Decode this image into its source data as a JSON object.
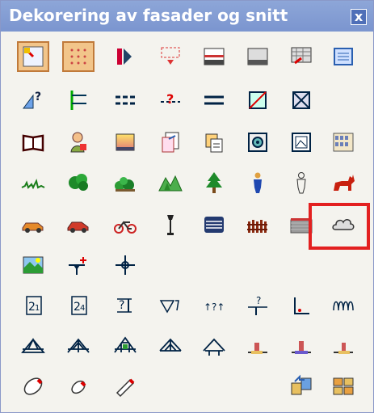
{
  "window": {
    "title": "Dekorering av fasader og snitt",
    "close_label": "x"
  },
  "colors": {
    "title_bar": "#8da6d8",
    "panel": "#f4f3ee",
    "active_button": "#f2c58a",
    "highlight": "#e32020"
  },
  "tools": [
    {
      "name": "tool-sheet-select",
      "icon": "sheet-select-icon",
      "active": true
    },
    {
      "name": "tool-dot-grid",
      "icon": "dot-grid-icon",
      "active": true
    },
    {
      "name": "tool-mirror",
      "icon": "mirror-icon"
    },
    {
      "name": "tool-dashed-dropdown",
      "icon": "dashed-dropdown-icon"
    },
    {
      "name": "tool-window-frame",
      "icon": "window-frame-icon"
    },
    {
      "name": "tool-gray-panel",
      "icon": "gray-panel-icon"
    },
    {
      "name": "tool-brick-pattern",
      "icon": "brick-pattern-icon"
    },
    {
      "name": "tool-blue-panel",
      "icon": "blue-panel-icon"
    },
    {
      "name": "tool-measure-query",
      "icon": "measure-query-icon"
    },
    {
      "name": "tool-branch-lines",
      "icon": "branch-lines-icon"
    },
    {
      "name": "tool-dashed-lines",
      "icon": "dashed-lines-icon"
    },
    {
      "name": "tool-line-query",
      "icon": "line-query-icon"
    },
    {
      "name": "tool-double-line",
      "icon": "double-line-icon"
    },
    {
      "name": "tool-crossed-box",
      "icon": "crossed-box-icon"
    },
    {
      "name": "tool-x-box",
      "icon": "x-box-icon"
    },
    {
      "name": "tool-book",
      "icon": "book-icon"
    },
    {
      "name": "tool-person",
      "icon": "person-icon"
    },
    {
      "name": "tool-gradient-box",
      "icon": "gradient-box-icon"
    },
    {
      "name": "tool-copy-document",
      "icon": "copy-document-icon"
    },
    {
      "name": "tool-duplicate",
      "icon": "duplicate-icon"
    },
    {
      "name": "tool-target-box",
      "icon": "target-box-icon"
    },
    {
      "name": "tool-picture-frame",
      "icon": "picture-frame-icon"
    },
    {
      "name": "tool-facade-pattern",
      "icon": "facade-pattern-icon"
    },
    {
      "name": "tool-grass",
      "icon": "grass-icon"
    },
    {
      "name": "tool-bush",
      "icon": "bush-icon"
    },
    {
      "name": "tool-shrubs",
      "icon": "shrubs-icon"
    },
    {
      "name": "tool-landscape",
      "icon": "landscape-icon"
    },
    {
      "name": "tool-tree",
      "icon": "tree-icon"
    },
    {
      "name": "tool-human-figure",
      "icon": "human-figure-icon"
    },
    {
      "name": "tool-outline-figure",
      "icon": "outline-figure-icon"
    },
    {
      "name": "tool-cat",
      "icon": "cat-icon"
    },
    {
      "name": "tool-car-orange",
      "icon": "car-orange-icon"
    },
    {
      "name": "tool-car-red",
      "icon": "car-red-icon"
    },
    {
      "name": "tool-bicycle",
      "icon": "bicycle-icon"
    },
    {
      "name": "tool-street-lamp",
      "icon": "street-lamp-icon"
    },
    {
      "name": "tool-stacked-lines",
      "icon": "stacked-lines-icon"
    },
    {
      "name": "tool-fence",
      "icon": "fence-icon"
    },
    {
      "name": "tool-wall",
      "icon": "wall-icon"
    },
    {
      "name": "tool-cloud",
      "icon": "cloud-icon"
    },
    {
      "name": "tool-landscape-photo",
      "icon": "landscape-photo-icon"
    },
    {
      "name": "tool-level-marker",
      "icon": "level-marker-icon"
    },
    {
      "name": "tool-crosshair",
      "icon": "crosshair-icon"
    },
    {
      "name": "tool-level-21",
      "icon": "level-21-icon"
    },
    {
      "name": "tool-level-24",
      "icon": "level-24-icon"
    },
    {
      "name": "tool-level-query",
      "icon": "level-query-icon"
    },
    {
      "name": "tool-slope-marker",
      "icon": "slope-marker-icon"
    },
    {
      "name": "tool-height-query",
      "icon": "height-query-icon"
    },
    {
      "name": "tool-level-down",
      "icon": "level-down-icon"
    },
    {
      "name": "tool-corner-line",
      "icon": "corner-line-icon"
    },
    {
      "name": "tool-insulation",
      "icon": "insulation-icon"
    },
    {
      "name": "tool-roof-truss-a",
      "icon": "roof-truss-a-icon"
    },
    {
      "name": "tool-roof-truss-b",
      "icon": "roof-truss-b-icon"
    },
    {
      "name": "tool-roof-truss-c",
      "icon": "roof-truss-c-icon"
    },
    {
      "name": "tool-roof-truss-d",
      "icon": "roof-truss-d-icon"
    },
    {
      "name": "tool-roof-truss-e",
      "icon": "roof-truss-e-icon"
    },
    {
      "name": "tool-foundation-a",
      "icon": "foundation-a-icon"
    },
    {
      "name": "tool-foundation-b",
      "icon": "foundation-b-icon"
    },
    {
      "name": "tool-foundation-c",
      "icon": "foundation-c-icon"
    },
    {
      "name": "tool-eraser-oval",
      "icon": "eraser-oval-icon"
    },
    {
      "name": "tool-eraser-small",
      "icon": "eraser-small-icon"
    },
    {
      "name": "tool-eraser-pencil",
      "icon": "eraser-pencil-icon"
    },
    {
      "name": "tool-export",
      "icon": "export-icon"
    },
    {
      "name": "tool-blocks",
      "icon": "blocks-icon"
    }
  ]
}
